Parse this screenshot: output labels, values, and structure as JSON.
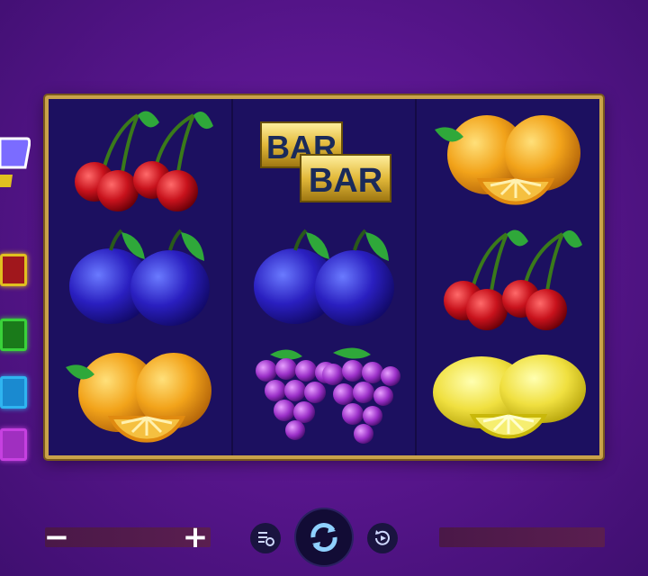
{
  "reels": [
    [
      "double-cherry",
      "double-plum",
      "double-orange"
    ],
    [
      "double-bar",
      "double-plum",
      "double-grapes"
    ],
    [
      "double-orange",
      "double-cherry",
      "double-lemon"
    ]
  ],
  "bar_symbol_text": "BAR",
  "controls": {
    "bet_decrease_label": "−",
    "bet_increase_label": "+",
    "paytable_icon": "paytable-settings-icon",
    "spin_icon": "spin-arrows-icon",
    "autoplay_icon": "autoplay-icon"
  },
  "colors": {
    "background": "#5a168f",
    "reel_frame": "#c9a24a",
    "reel_background": "#1c1060",
    "side_button_1": "#e0c020",
    "side_button_2": "#3ad23a",
    "side_button_3": "#2fb4f0",
    "side_button_4": "#c640e0"
  }
}
